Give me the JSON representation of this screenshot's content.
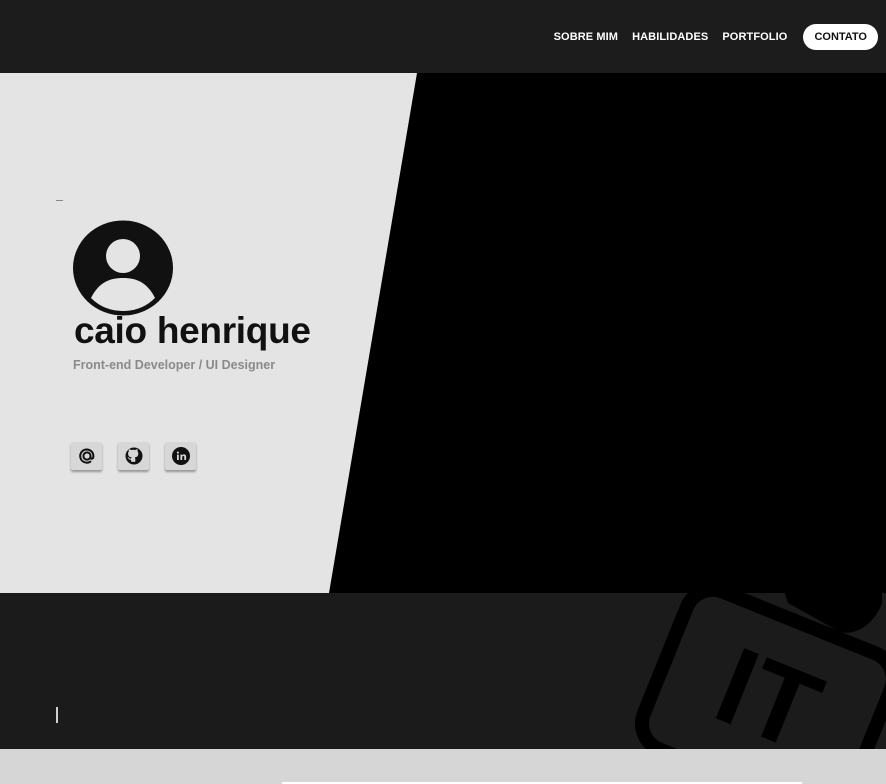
{
  "nav": {
    "links": [
      "SOBRE MIM",
      "HABILIDADES",
      "PORTFOLIO"
    ],
    "contact": "CONTATO"
  },
  "hero": {
    "name": "caio henrique",
    "role": "Front-end Developer / UI Designer",
    "avatar_icon": "user-circle-icon",
    "socials": [
      {
        "icon": "at-sign-icon"
      },
      {
        "icon": "github-icon"
      },
      {
        "icon": "linkedin-icon"
      }
    ]
  },
  "section2": {
    "badge_text": "IT"
  },
  "colors": {
    "topbar": "#1c1c1c",
    "hero_panel": "#e4e4e4",
    "hero_dark": "#000000",
    "section_dark": "#1b1b1b",
    "text_dark": "#111111",
    "text_muted": "#8a8a8a"
  }
}
